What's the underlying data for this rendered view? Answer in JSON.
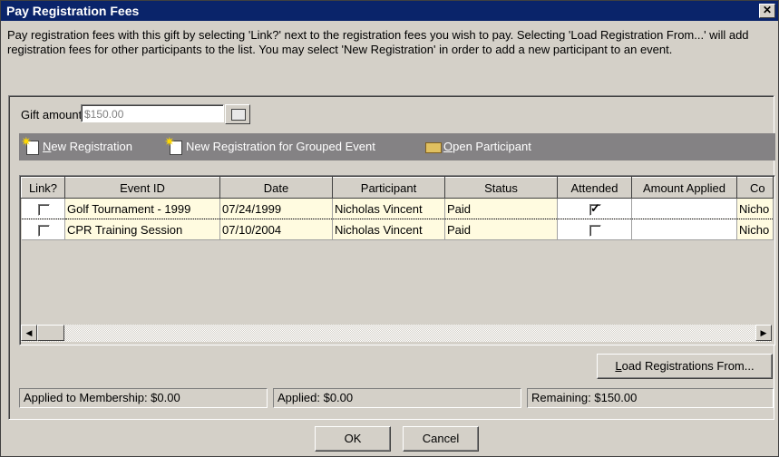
{
  "window": {
    "title": "Pay Registration Fees",
    "close_glyph": "✕"
  },
  "intro_text": "Pay registration fees with this gift by selecting 'Link?' next to the registration fees you wish to pay.  Selecting 'Load Registration From...' will add registration fees for other participants to the list.  You may select 'New Registration' in order to add a new participant to an event.",
  "gift": {
    "label": "Gift amount:",
    "value": "$150.00",
    "icon": "calculator-icon"
  },
  "toolbar": {
    "new_registration": {
      "first": "N",
      "rest": "ew Registration",
      "icon": "new-document-star-icon"
    },
    "new_grouped": {
      "label": "New Registration for Grouped Event",
      "icon": "new-document-star-icon"
    },
    "open_participant": {
      "first": "O",
      "rest": "pen Participant",
      "icon": "open-folder-icon"
    }
  },
  "table": {
    "headers": [
      "Link?",
      "Event ID",
      "Date",
      "Participant",
      "Status",
      "Attended",
      "Amount Applied",
      "Co"
    ],
    "rows": [
      {
        "link": false,
        "event_id": "Golf Tournament - 1999",
        "date": "07/24/1999",
        "participant": "Nicholas Vincent",
        "status": "Paid",
        "attended": true,
        "amount": "",
        "contact": "Nicho"
      },
      {
        "link": false,
        "event_id": "CPR Training Session",
        "date": "07/10/2004",
        "participant": "Nicholas Vincent",
        "status": "Paid",
        "attended": false,
        "amount": "",
        "contact": "Nicho"
      }
    ]
  },
  "load_button": {
    "first": "L",
    "rest": "oad Registrations From..."
  },
  "status": {
    "membership": "Applied to Membership:  $0.00",
    "applied": "Applied:  $0.00",
    "remaining": "Remaining:  $150.00"
  },
  "buttons": {
    "ok": "OK",
    "cancel": "Cancel"
  },
  "colors": {
    "titlebar": "#0a246a",
    "toolbar": "#848284",
    "face": "#d4d0c8",
    "row_highlight": "#fffbe0"
  }
}
